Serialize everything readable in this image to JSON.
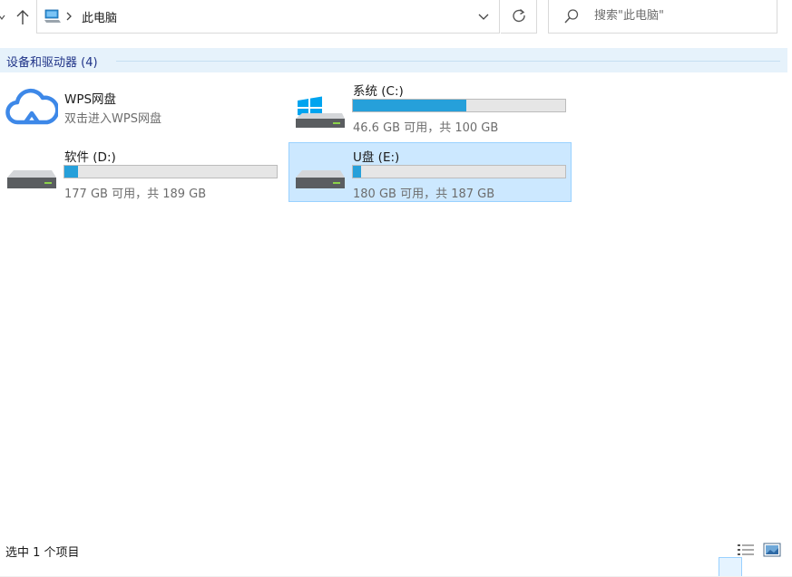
{
  "address": {
    "crumb": "此电脑",
    "search_placeholder": "搜索\"此电脑\""
  },
  "group": {
    "title": "设备和驱动器 (4)"
  },
  "items": [
    {
      "name": "WPS网盘",
      "subtitle": "双击进入WPS网盘",
      "icon": "cloud-icon"
    },
    {
      "name": "系统 (C:)",
      "space": "46.6 GB 可用，共 100 GB",
      "used_fraction": 0.534,
      "icon": "windows-drive-icon"
    },
    {
      "name": "软件 (D:)",
      "space": "177 GB 可用，共 189 GB",
      "used_fraction": 0.063,
      "icon": "hard-drive-icon"
    },
    {
      "name": "U盘 (E:)",
      "space": "180 GB 可用，共 187 GB",
      "used_fraction": 0.037,
      "icon": "hard-drive-icon",
      "selected": true
    }
  ],
  "status": {
    "selection": "选中 1 个项目"
  },
  "colors": {
    "accent": "#26a0da",
    "selection_bg": "#cce8ff",
    "selection_border": "#99d1ff",
    "group_title": "#1e3287",
    "windows_logo": "#00a4ef"
  }
}
